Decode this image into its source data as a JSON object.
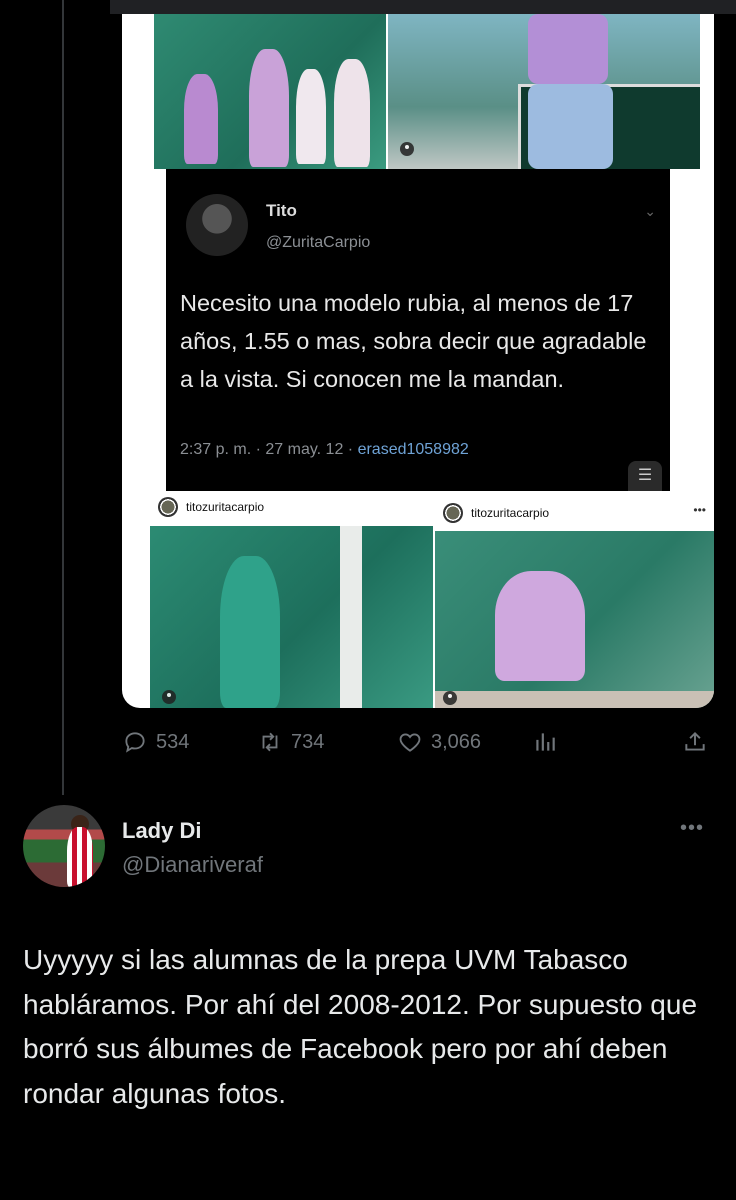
{
  "embedded_tweet": {
    "name": "Tito",
    "handle": "@ZuritaCarpio",
    "text": "Necesito una modelo rubia, al menos de 17 años, 1.55 o mas, sobra decir que agradable a la vista. Si conocen me la mandan.",
    "timestamp": "2:37 p. m. · 27 may. 12 · ",
    "watermark": "erased1058982"
  },
  "instagram_posts": [
    {
      "username": "titozuritacarpio"
    },
    {
      "username": "titozuritacarpio"
    }
  ],
  "actions": {
    "reply_count": "534",
    "retweet_count": "734",
    "like_count": "3,066"
  },
  "reply_tweet": {
    "name": "Lady Di",
    "handle": "@Dianariveraf",
    "more": "•••",
    "text": "Uyyyyy si las alumnas de la prepa UVM Tabasco habláramos. Por ahí del 2008-2012. Por supuesto que borró sus álbumes de Facebook pero por ahí deben rondar algunas fotos."
  },
  "icons": [
    "reply-icon",
    "retweet-icon",
    "like-icon",
    "views-icon",
    "share-icon",
    "more-icon"
  ],
  "colors": {
    "background": "#000000",
    "text": "#e7e9ea",
    "secondary": "#71767b",
    "link": "#6fa3d6"
  }
}
